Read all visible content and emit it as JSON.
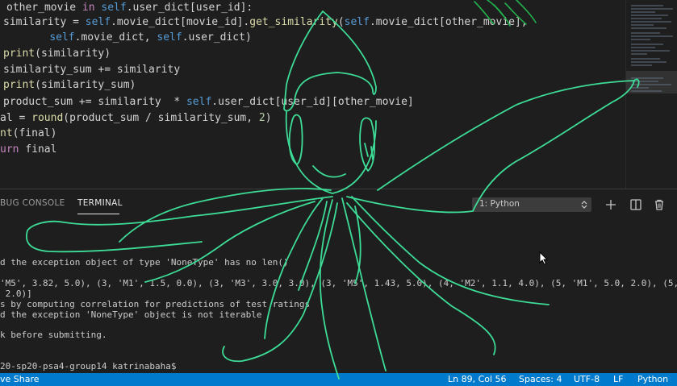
{
  "editor": {
    "lines": [
      {
        "segments": [
          {
            "t": "other_movie ",
            "c": ""
          },
          {
            "t": "in ",
            "c": "kw"
          },
          {
            "t": "self",
            "c": "sf"
          },
          {
            "t": ".user_dict[user_id]:",
            "c": ""
          }
        ]
      },
      {
        "segments": [
          {
            "t": "similarity = ",
            "c": ""
          },
          {
            "t": "self",
            "c": "sf"
          },
          {
            "t": ".movie_dict[movie_id].",
            "c": ""
          },
          {
            "t": "get_similarity",
            "c": "fn"
          },
          {
            "t": "(",
            "c": ""
          },
          {
            "t": "self",
            "c": "sf"
          },
          {
            "t": ".movie_dict[other_movie],",
            "c": ""
          }
        ]
      },
      {
        "segments": [
          {
            "t": "    ",
            "c": ""
          },
          {
            "t": "self",
            "c": "sf"
          },
          {
            "t": ".movie_dict, ",
            "c": ""
          },
          {
            "t": "self",
            "c": "sf"
          },
          {
            "t": ".user_dict)",
            "c": ""
          }
        ]
      },
      {
        "segments": [
          {
            "t": "print",
            "c": "fn"
          },
          {
            "t": "(similarity)",
            "c": ""
          }
        ]
      },
      {
        "segments": [
          {
            "t": "similarity_sum += similarity",
            "c": ""
          }
        ]
      },
      {
        "segments": [
          {
            "t": "print",
            "c": "fn"
          },
          {
            "t": "(similarity_sum)",
            "c": ""
          }
        ]
      },
      {
        "segments": [
          {
            "t": "product_sum += similarity  * ",
            "c": ""
          },
          {
            "t": "self",
            "c": "sf"
          },
          {
            "t": ".user_dict[user_id][other_movie]",
            "c": ""
          }
        ]
      },
      {
        "segments": [
          {
            "t": "al = ",
            "c": ""
          },
          {
            "t": "round",
            "c": "fn"
          },
          {
            "t": "(product_sum / similarity_sum, ",
            "c": ""
          },
          {
            "t": "2",
            "c": "num"
          },
          {
            "t": ")",
            "c": ""
          }
        ]
      },
      {
        "segments": [
          {
            "t": "nt",
            "c": "fn"
          },
          {
            "t": "(final)",
            "c": ""
          }
        ]
      },
      {
        "segments": [
          {
            "t": "urn ",
            "c": "kw"
          },
          {
            "t": "final",
            "c": ""
          }
        ]
      }
    ]
  },
  "panel": {
    "tabs": [
      {
        "label": "BUG CONSOLE",
        "active": false
      },
      {
        "label": "TERMINAL",
        "active": true
      }
    ],
    "shell_select": {
      "value": "1: Python"
    },
    "icons": [
      "plus-icon",
      "split-icon",
      "trash-icon"
    ]
  },
  "terminal": {
    "lines": [
      "d the exception object of type 'NoneType' has no len()",
      "",
      "'M5', 3.82, 5.0), (3, 'M1', 1.5, 0.0), (3, 'M3', 3.0, 3.0), (3, 'M5', 1.43, 5.0), (4, 'M2', 1.1, 4.0), (5, 'M1', 5.0, 2.0), (5,",
      " 2.0)]",
      "s by computing correlation for predictions of test ratings",
      "d the exception 'NoneType' object is not iterable",
      "",
      "k before submitting.",
      "",
      "",
      "20-sp20-psa4-group14 katrinabaha$"
    ]
  },
  "status": {
    "left": "ve Share",
    "position": "Ln 89, Col 56",
    "spaces": "Spaces: 4",
    "encoding": "UTF-8",
    "eol": "LF",
    "language": "Python"
  },
  "colors": {
    "status_bar": "#007acc",
    "drawing_stroke": "#3ddc97",
    "drawing_stroke_alt": "#22b14c",
    "keyword": "#c586c0",
    "self": "#569cd6",
    "function": "#dcdcaa"
  }
}
